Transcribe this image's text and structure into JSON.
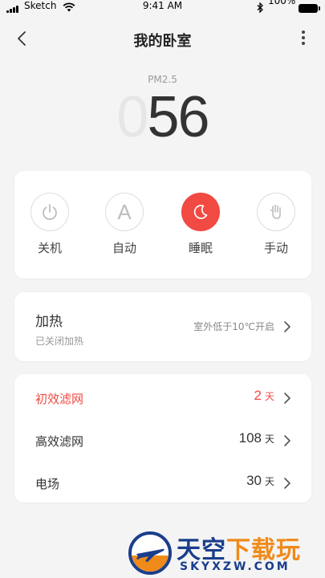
{
  "status_bar": {
    "carrier": "Sketch",
    "time": "9:41 AM",
    "battery_pct": "100%"
  },
  "nav": {
    "title": "我的卧室"
  },
  "pm": {
    "label": "PM2.5",
    "lead_digit": "0",
    "value": "56"
  },
  "modes": [
    {
      "label": "关机",
      "icon": "power-icon",
      "active": false
    },
    {
      "label": "自动",
      "icon": "letter-a-icon",
      "letter": "A",
      "active": false
    },
    {
      "label": "睡眠",
      "icon": "moon-icon",
      "active": true
    },
    {
      "label": "手动",
      "icon": "hand-icon",
      "active": false
    }
  ],
  "heating": {
    "title": "加热",
    "status": "已关闭加热",
    "note": "室外低于10℃开启"
  },
  "filters": [
    {
      "label": "初效滤网",
      "value": "2",
      "unit": "天",
      "alert": true
    },
    {
      "label": "高效滤网",
      "value": "108",
      "unit": "天",
      "alert": false
    },
    {
      "label": "电场",
      "value": "30",
      "unit": "天",
      "alert": false
    }
  ],
  "watermark": {
    "text_blue": "天空",
    "text_orange": "下载玩",
    "domain": "SKYXZW.COM"
  },
  "colors": {
    "accent": "#f04a43",
    "background": "#f4f4f4",
    "card": "#ffffff"
  }
}
